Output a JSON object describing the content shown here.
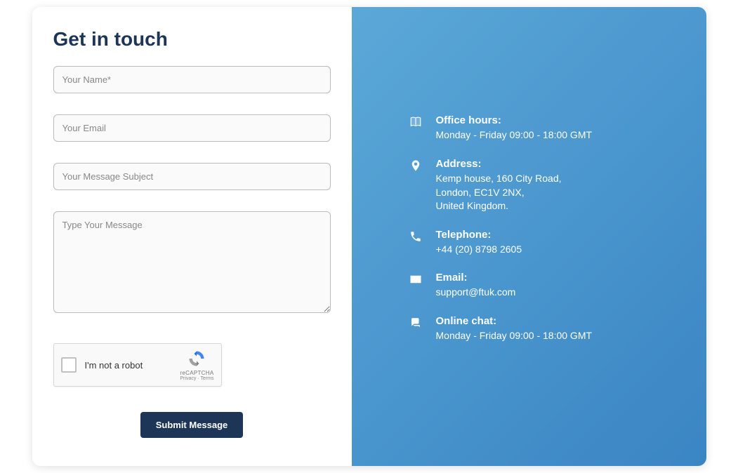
{
  "heading": "Get in touch",
  "form": {
    "name_placeholder": "Your Name*",
    "email_placeholder": "Your Email",
    "subject_placeholder": "Your Message Subject",
    "message_placeholder": "Type Your Message",
    "submit_label": "Submit Message"
  },
  "recaptcha": {
    "label": "I'm not a robot",
    "brand": "reCAPTCHA",
    "terms": "Privacy · Terms"
  },
  "info": {
    "office_hours": {
      "label": "Office hours:",
      "value": "Monday - Friday 09:00 - 18:00 GMT"
    },
    "address": {
      "label": "Address:",
      "value": "Kemp house, 160 City Road,\nLondon, EC1V 2NX,\nUnited Kingdom."
    },
    "telephone": {
      "label": "Telephone:",
      "value": "+44 (20) 8798 2605"
    },
    "email": {
      "label": "Email:",
      "value": "support@ftuk.com"
    },
    "chat": {
      "label": "Online chat:",
      "value": "Monday - Friday 09:00 - 18:00 GMT"
    }
  }
}
